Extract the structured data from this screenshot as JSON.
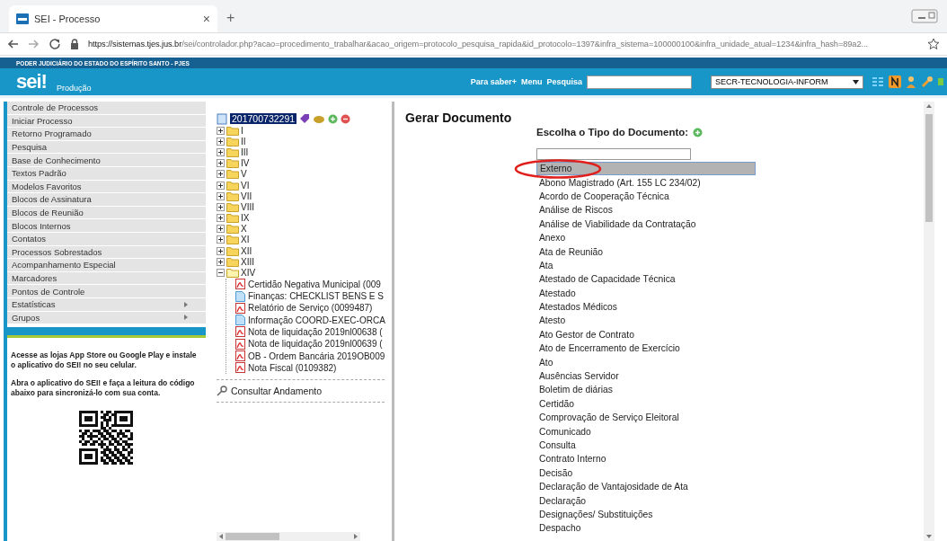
{
  "browser": {
    "tab_title": "SEI - Processo",
    "tab_close": "×",
    "new_tab": "+",
    "url_host": "https://sistemas.tjes.jus.br",
    "url_path": "/sei/controlador.php?acao=procedimento_trabalhar&acao_origem=protocolo_pesquisa_rapida&id_protocolo=1397&infra_sistema=100000100&infra_unidade_atual=1234&infra_hash=89a2..."
  },
  "header": {
    "org": "PODER JUDICIÁRIO DO ESTADO DO ESPÍRITO SANTO - PJES",
    "logo": "sei",
    "logo_mark": "!",
    "environment": "Produção",
    "links": [
      "Para saber+",
      "Menu",
      "Pesquisa"
    ],
    "unit": "SECR-TECNOLOGIA-INFORM"
  },
  "sidebar": {
    "items": [
      {
        "label": "Controle de Processos",
        "submenu": false
      },
      {
        "label": "Iniciar Processo",
        "submenu": false
      },
      {
        "label": "Retorno Programado",
        "submenu": false
      },
      {
        "label": "Pesquisa",
        "submenu": false
      },
      {
        "label": "Base de Conhecimento",
        "submenu": false
      },
      {
        "label": "Textos Padrão",
        "submenu": false
      },
      {
        "label": "Modelos Favoritos",
        "submenu": false
      },
      {
        "label": "Blocos de Assinatura",
        "submenu": false
      },
      {
        "label": "Blocos de Reunião",
        "submenu": false
      },
      {
        "label": "Blocos Internos",
        "submenu": false
      },
      {
        "label": "Contatos",
        "submenu": false
      },
      {
        "label": "Processos Sobrestados",
        "submenu": false
      },
      {
        "label": "Acompanhamento Especial",
        "submenu": false
      },
      {
        "label": "Marcadores",
        "submenu": false
      },
      {
        "label": "Pontos de Controle",
        "submenu": false
      },
      {
        "label": "Estatísticas",
        "submenu": true
      },
      {
        "label": "Grupos",
        "submenu": true
      }
    ],
    "app_text_1": "Acesse as lojas App Store ou Google Play e instale o aplicativo do SEI! no seu celular.",
    "app_text_2": "Abra o aplicativo do SEI! e faça a leitura do código abaixo para sincronizá-lo com sua conta."
  },
  "tree": {
    "process": "201700732291",
    "folders": [
      {
        "label": "I",
        "expanded": false
      },
      {
        "label": "II",
        "expanded": false
      },
      {
        "label": "III",
        "expanded": false
      },
      {
        "label": "IV",
        "expanded": false
      },
      {
        "label": "V",
        "expanded": false
      },
      {
        "label": "VI",
        "expanded": false
      },
      {
        "label": "VII",
        "expanded": false
      },
      {
        "label": "VIII",
        "expanded": false
      },
      {
        "label": "IX",
        "expanded": false
      },
      {
        "label": "X",
        "expanded": false
      },
      {
        "label": "XI",
        "expanded": false
      },
      {
        "label": "XII",
        "expanded": false
      },
      {
        "label": "XIII",
        "expanded": false
      },
      {
        "label": "XIV",
        "expanded": true,
        "children": [
          {
            "label": "Certidão Negativa Municipal (009",
            "kind": "pdf"
          },
          {
            "label": "Finanças: CHECKLIST BENS E S",
            "kind": "doc"
          },
          {
            "label": "Relatório de Serviço (0099487)",
            "kind": "pdf"
          },
          {
            "label": "Informação COORD-EXEC-ORCA",
            "kind": "doc"
          },
          {
            "label": "Nota de liquidação 2019nl00638 (",
            "kind": "pdf"
          },
          {
            "label": "Nota de liquidação 2019nl00639 (",
            "kind": "pdf"
          },
          {
            "label": "OB - Ordem Bancária 2019OB009",
            "kind": "pdf"
          },
          {
            "label": "Nota Fiscal (0109382)",
            "kind": "pdf"
          }
        ]
      }
    ],
    "consult": "Consultar Andamento"
  },
  "main": {
    "title": "Gerar Documento",
    "prompt": "Escolha o Tipo do Documento:",
    "types": [
      {
        "label": "Externo",
        "selected": true
      },
      {
        "label": "Abono Magistrado (Art. 155 LC 234/02)",
        "selected": false
      },
      {
        "label": "Acordo de Cooperação Técnica",
        "selected": false
      },
      {
        "label": "Análise de Riscos",
        "selected": false
      },
      {
        "label": "Análise de Viabilidade da Contratação",
        "selected": false
      },
      {
        "label": "Anexo",
        "selected": false
      },
      {
        "label": "Ata de Reunião",
        "selected": false
      },
      {
        "label": "Ata",
        "selected": false
      },
      {
        "label": "Atestado de Capacidade Técnica",
        "selected": false
      },
      {
        "label": "Atestado",
        "selected": false
      },
      {
        "label": "Atestados Médicos",
        "selected": false
      },
      {
        "label": "Atesto",
        "selected": false
      },
      {
        "label": "Ato Gestor de Contrato",
        "selected": false
      },
      {
        "label": "Ato de Encerramento de Exercício",
        "selected": false
      },
      {
        "label": "Ato",
        "selected": false
      },
      {
        "label": "Ausências Servidor",
        "selected": false
      },
      {
        "label": "Boletim de diárias",
        "selected": false
      },
      {
        "label": "Certidão",
        "selected": false
      },
      {
        "label": "Comprovação de Serviço Eleitoral",
        "selected": false
      },
      {
        "label": "Comunicado",
        "selected": false
      },
      {
        "label": "Consulta",
        "selected": false
      },
      {
        "label": "Contrato Interno",
        "selected": false
      },
      {
        "label": "Decisão",
        "selected": false
      },
      {
        "label": "Declaração de Vantajosidade de Ata",
        "selected": false
      },
      {
        "label": "Declaração",
        "selected": false
      },
      {
        "label": "Designações/ Substituições",
        "selected": false
      },
      {
        "label": "Despacho",
        "selected": false
      }
    ]
  }
}
